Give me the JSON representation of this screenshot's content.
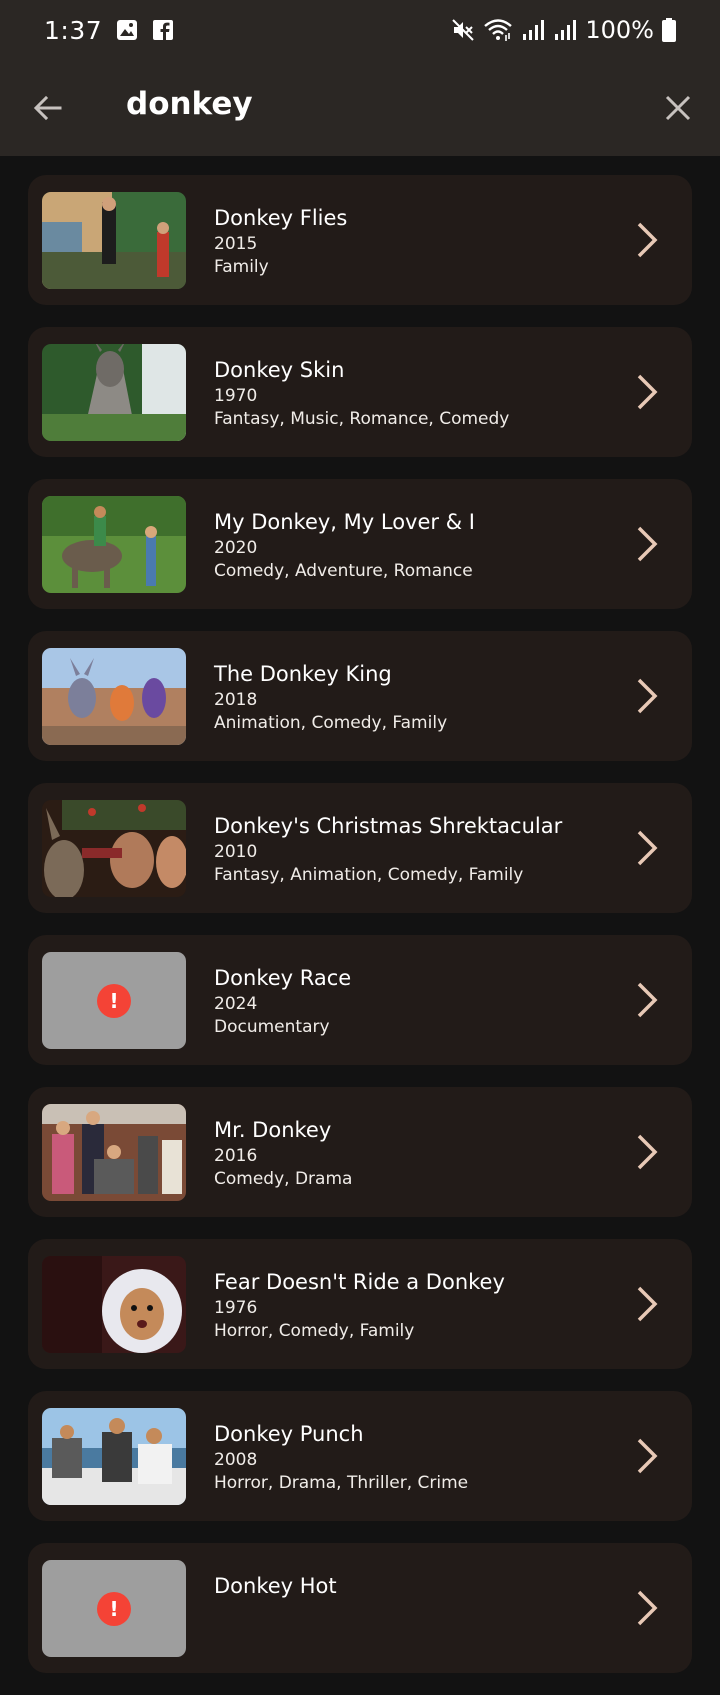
{
  "status": {
    "time": "1:37",
    "battery": "100%",
    "icons": [
      "gallery-icon",
      "facebook-icon",
      "mute-icon",
      "wifi-icon",
      "signal-icon",
      "signal-icon",
      "battery-icon"
    ]
  },
  "search": {
    "query": "donkey",
    "back_icon": "arrow-left-icon",
    "clear_icon": "close-icon"
  },
  "colors": {
    "accent_chevron": "#e8c9b6",
    "card_bg": "#221b18",
    "topbar_bg": "#2b2724",
    "error_red": "#f44336"
  },
  "results": [
    {
      "title": "Donkey Flies",
      "year": "2015",
      "genres": "Family",
      "thumb": "photo"
    },
    {
      "title": "Donkey Skin",
      "year": "1970",
      "genres": "Fantasy, Music, Romance, Comedy",
      "thumb": "photo"
    },
    {
      "title": "My Donkey, My Lover & I",
      "year": "2020",
      "genres": "Comedy, Adventure, Romance",
      "thumb": "photo"
    },
    {
      "title": "The Donkey King",
      "year": "2018",
      "genres": "Animation, Comedy, Family",
      "thumb": "photo"
    },
    {
      "title": "Donkey's Christmas Shrektacular",
      "year": "2010",
      "genres": "Fantasy, Animation, Comedy, Family",
      "thumb": "photo"
    },
    {
      "title": "Donkey Race",
      "year": "2024",
      "genres": "Documentary",
      "thumb": "error"
    },
    {
      "title": "Mr. Donkey",
      "year": "2016",
      "genres": "Comedy, Drama",
      "thumb": "photo"
    },
    {
      "title": "Fear Doesn't Ride a Donkey",
      "year": "1976",
      "genres": "Horror, Comedy, Family",
      "thumb": "photo"
    },
    {
      "title": "Donkey Punch",
      "year": "2008",
      "genres": "Horror, Drama, Thriller, Crime",
      "thumb": "photo"
    },
    {
      "title": "Donkey Hot",
      "year": "",
      "genres": "",
      "thumb": "error"
    }
  ]
}
